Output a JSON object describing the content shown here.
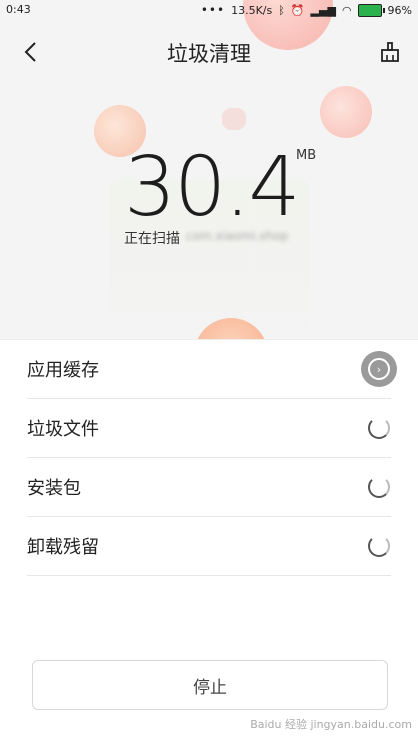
{
  "status_bar": {
    "time": "0:43",
    "speed": "13.5K/s",
    "battery_percent": "96%",
    "icons": [
      "bluetooth-icon",
      "alarm-icon",
      "signal-icon",
      "wifi-icon",
      "battery-icon"
    ]
  },
  "header": {
    "title": "垃圾清理",
    "back_icon": "chevron-left-icon",
    "clean_icon": "broom-icon"
  },
  "scan": {
    "value": "30.4",
    "unit": "MB",
    "label": "正在扫描",
    "path": "com.xiaomi.shop"
  },
  "items": [
    {
      "label": "应用缓存",
      "state": "arrow"
    },
    {
      "label": "垃圾文件",
      "state": "loading"
    },
    {
      "label": "安装包",
      "state": "loading"
    },
    {
      "label": "卸载残留",
      "state": "loading"
    }
  ],
  "stop_label": "停止",
  "watermark": "Baidu 经验 jingyan.baidu.com",
  "colors": {
    "battery": "#2bb24c",
    "bubble": "#f5a27b",
    "indicator": "#9a9a9a"
  }
}
